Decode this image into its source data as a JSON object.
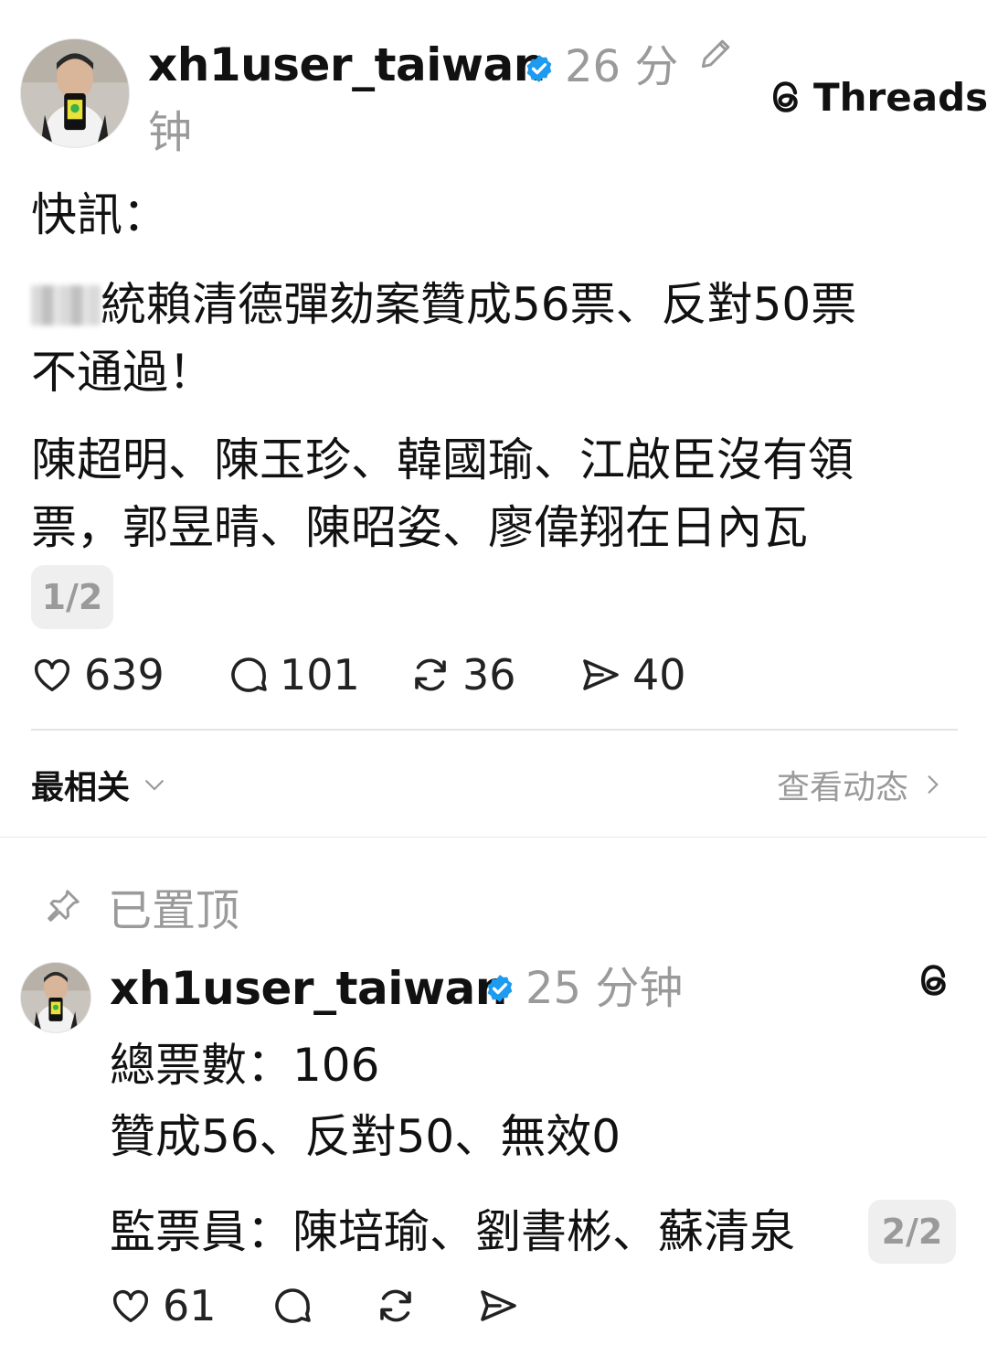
{
  "post": {
    "username": "xh1user_taiwan",
    "time_part1": "26 分",
    "time_part2": "钟",
    "brand": "Threads",
    "heading": "快訊：",
    "para1_line1": "統賴清德彈劾案贊成56票、反對50票",
    "para1_line2": "不通過！",
    "para2_line1": "陳超明、陳玉珍、韓國瑜、江啟臣沒有領",
    "para2_line2": "票，郭昱晴、陳昭姿、廖偉翔在日內瓦",
    "page_badge": "1/2",
    "likes": "639",
    "comments": "101",
    "reposts": "36",
    "shares": "40"
  },
  "sort_bar": {
    "label": "最相关",
    "view_activity": "查看动态"
  },
  "pinned": {
    "label": "已置顶",
    "username": "xh1user_taiwan",
    "time": "25 分钟",
    "line1": "總票數：106",
    "line2": "贊成56、反對50、無效0",
    "line3": "監票員：陳培瑜、劉書彬、蘇清泉",
    "page_badge": "2/2",
    "likes": "61"
  },
  "colors": {
    "verified": "#1d9bf0",
    "meta_gray": "#9a9a9a",
    "text": "#111111"
  }
}
